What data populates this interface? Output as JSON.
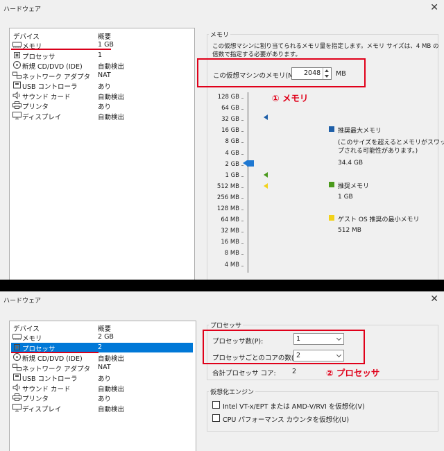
{
  "window_title": "ハードウェア",
  "close_glyph": "✕",
  "list_headers": {
    "device": "デバイス",
    "summary": "概要"
  },
  "memory_panel": {
    "devices": [
      {
        "name": "メモリ",
        "summary": "1 GB",
        "icon": "memory-icon"
      },
      {
        "name": "プロセッサ",
        "summary": "1",
        "icon": "processor-icon"
      },
      {
        "name": "新規 CD/DVD (IDE)",
        "summary": "自動検出",
        "icon": "cd-dvd-icon"
      },
      {
        "name": "ネットワーク アダプタ",
        "summary": "NAT",
        "icon": "network-icon"
      },
      {
        "name": "USB コントローラ",
        "summary": "あり",
        "icon": "usb-icon"
      },
      {
        "name": "サウンド カード",
        "summary": "自動検出",
        "icon": "sound-icon"
      },
      {
        "name": "プリンタ",
        "summary": "あり",
        "icon": "printer-icon"
      },
      {
        "name": "ディスプレイ",
        "summary": "自動検出",
        "icon": "display-icon"
      }
    ],
    "group_label": "メモリ",
    "description": [
      "この仮想マシンに割り当てられるメモリ量を指定します。メモリ サイズは、4 MB の",
      "倍数で指定する必要があります。"
    ],
    "field_label": "この仮想マシンのメモリ(M):",
    "field_value": "2048",
    "unit": "MB",
    "annotation": "① メモリ",
    "scale_labels": [
      "128 GB",
      "64 GB",
      "32 GB",
      "16 GB",
      "8 GB",
      "4 GB",
      "2 GB",
      "1 GB",
      "512 MB",
      "256 MB",
      "128 MB",
      "64 MB",
      "32 MB",
      "16 MB",
      "8 MB",
      "4 MB"
    ],
    "legend": {
      "max_title": "推奨最大メモリ",
      "max_note": [
        "(このサイズを超えるとメモリがスワッ",
        "プされる可能性があります。)"
      ],
      "max_value": "34.4 GB",
      "rec_title": "推奨メモリ",
      "rec_value": "1 GB",
      "min_title": "ゲスト OS 推奨の最小メモリ",
      "min_value": "512 MB"
    },
    "colors": {
      "max": "#1e5fa8",
      "rec": "#4a9a1c",
      "min": "#f2d21a",
      "slider": "#1e78d2"
    }
  },
  "processor_panel": {
    "devices": [
      {
        "name": "メモリ",
        "summary": "2 GB",
        "icon": "memory-icon"
      },
      {
        "name": "プロセッサ",
        "summary": "2",
        "icon": "processor-icon"
      },
      {
        "name": "新規 CD/DVD (IDE)",
        "summary": "自動検出",
        "icon": "cd-dvd-icon"
      },
      {
        "name": "ネットワーク アダプタ",
        "summary": "NAT",
        "icon": "network-icon"
      },
      {
        "name": "USB コントローラ",
        "summary": "あり",
        "icon": "usb-icon"
      },
      {
        "name": "サウンド カード",
        "summary": "自動検出",
        "icon": "sound-icon"
      },
      {
        "name": "プリンタ",
        "summary": "あり",
        "icon": "printer-icon"
      },
      {
        "name": "ディスプレイ",
        "summary": "自動検出",
        "icon": "display-icon"
      }
    ],
    "group_label": "プロセッサ",
    "proc_count_label": "プロセッサ数(P):",
    "proc_count_value": "1",
    "cores_label": "プロセッサごとのコアの数(C):",
    "cores_value": "2",
    "total_label": "合計プロセッサ コア:",
    "total_value": "2",
    "annotation": "② プロセッサ",
    "virt_group_label": "仮想化エンジン",
    "virt_option1": "Intel VT-x/EPT または AMD-V/RVI を仮想化(V)",
    "virt_option2": "CPU パフォーマンス カウンタを仮想化(U)"
  }
}
